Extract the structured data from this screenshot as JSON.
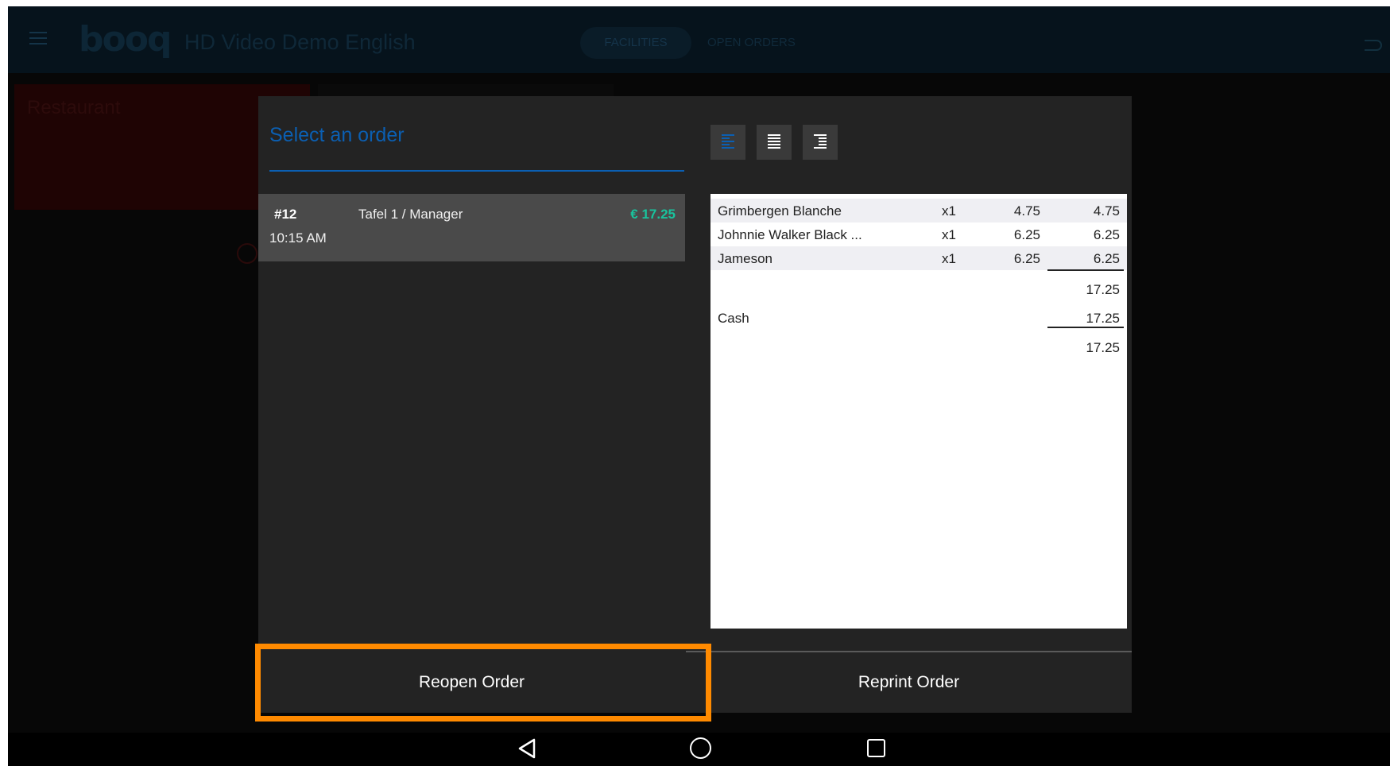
{
  "app": {
    "logo": "booq",
    "title": "HD Video Demo English",
    "tabs": [
      "FACILITIES",
      "OPEN ORDERS"
    ],
    "tile_label": "Restaurant"
  },
  "dialog": {
    "title": "Select an order",
    "alignment_icons": [
      "align-left-icon",
      "align-justify-icon",
      "align-indent-icon"
    ],
    "orders": [
      {
        "number": "#12",
        "table": "Tafel 1 / Manager",
        "time": "10:15 AM",
        "total": "€ 17.25"
      }
    ],
    "receipt": {
      "items": [
        {
          "name": "Grimbergen Blanche",
          "qty": "x1",
          "price": "4.75",
          "total": "4.75"
        },
        {
          "name": "Johnnie Walker Black ...",
          "qty": "x1",
          "price": "6.25",
          "total": "6.25"
        },
        {
          "name": "Jameson",
          "qty": "x1",
          "price": "6.25",
          "total": "6.25"
        }
      ],
      "subtotal": "17.25",
      "payment_method": "Cash",
      "payment_amount": "17.25",
      "balance": "17.25"
    },
    "reopen_label": "Reopen Order",
    "reprint_label": "Reprint Order"
  },
  "colors": {
    "accent": "#0b5fb2",
    "price": "#19c39d",
    "highlight": "#ff8a00"
  }
}
